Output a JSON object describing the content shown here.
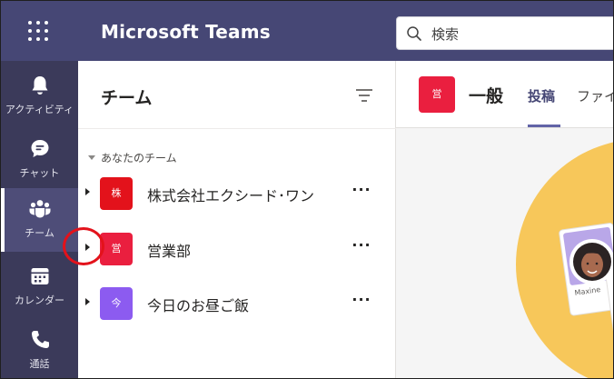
{
  "header": {
    "app_title": "Microsoft Teams",
    "search_placeholder": "検索"
  },
  "rail": {
    "items": [
      {
        "label": "アクティビティ",
        "icon": "bell-icon"
      },
      {
        "label": "チャット",
        "icon": "chat-icon"
      },
      {
        "label": "チーム",
        "icon": "teams-icon",
        "active": true
      },
      {
        "label": "カレンダー",
        "icon": "calendar-icon"
      },
      {
        "label": "通話",
        "icon": "phone-icon"
      }
    ]
  },
  "panel": {
    "title": "チーム",
    "section_label": "あなたのチーム",
    "teams": [
      {
        "name": "株式会社エクシード･ワン",
        "avatar_text": "株",
        "color": "#e3121b"
      },
      {
        "name": "営業部",
        "avatar_text": "営",
        "color": "#ea1f3f"
      },
      {
        "name": "今日のお昼ご飯",
        "avatar_text": "今",
        "color": "#8c5bf0"
      }
    ],
    "more_label": "···"
  },
  "content": {
    "avatar_text": "営",
    "channel_title": "一般",
    "tabs": [
      "投稿",
      "ファイル"
    ],
    "active_tab": "投稿",
    "illustration_name": "Maxine"
  },
  "colors": {
    "header": "#464775",
    "rail": "#3b3a5a",
    "accent": "#6264a7",
    "annotation": "#e3121b"
  }
}
